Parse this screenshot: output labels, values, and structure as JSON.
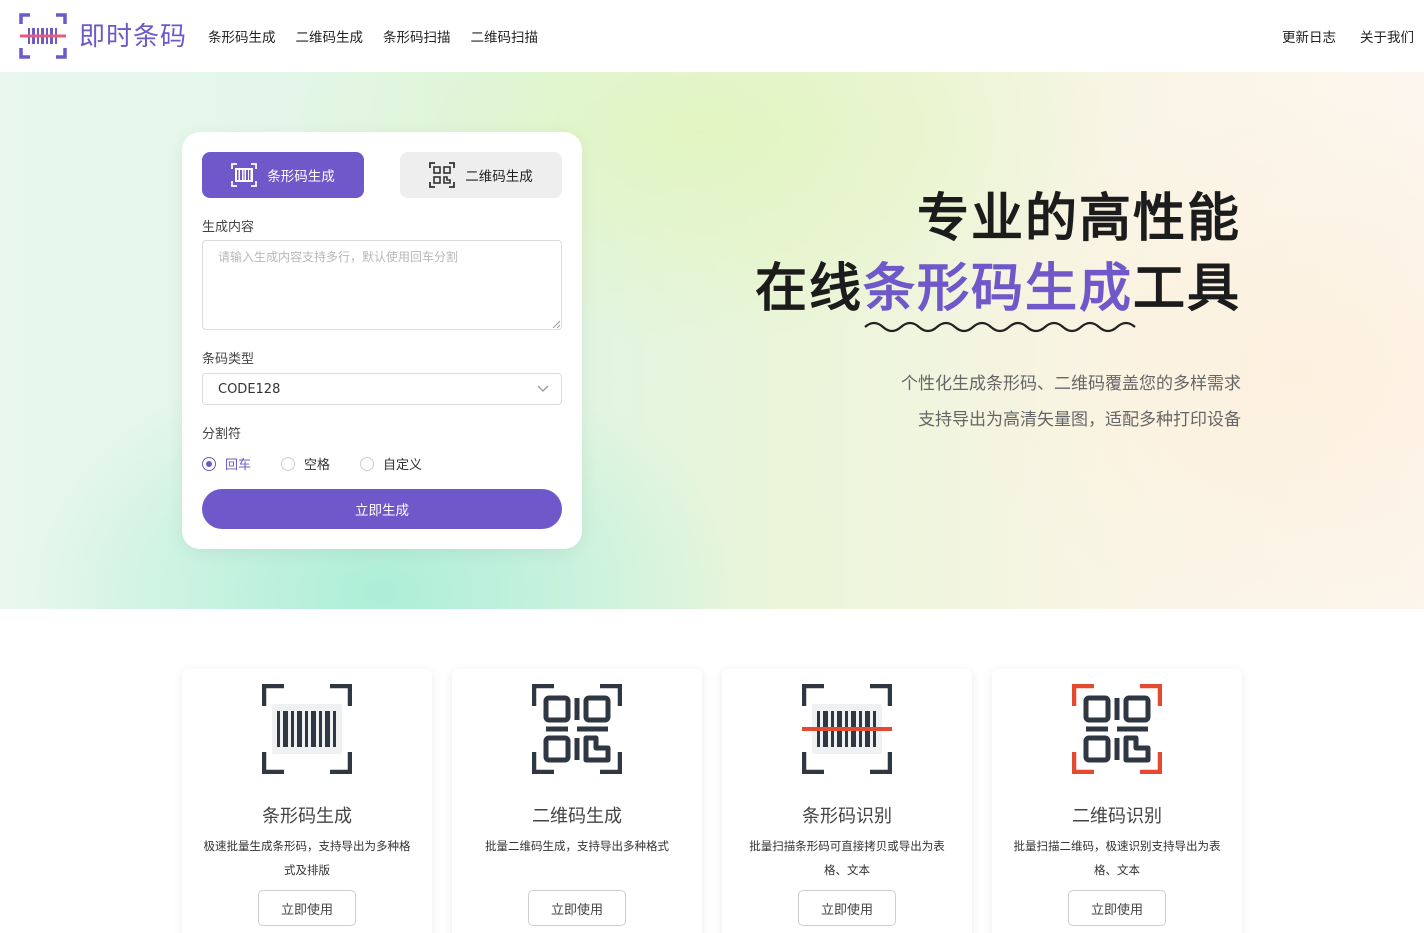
{
  "header": {
    "brand": "即时条码",
    "nav": [
      "条形码生成",
      "二维码生成",
      "条形码扫描",
      "二维码扫描"
    ],
    "nav_right": [
      "更新日志",
      "关于我们"
    ]
  },
  "generator": {
    "tab_barcode": "条形码生成",
    "tab_qrcode": "二维码生成",
    "content_label": "生成内容",
    "content_placeholder": "请输入生成内容支持多行，默认使用回车分割",
    "type_label": "条码类型",
    "type_value": "CODE128",
    "separator_label": "分割符",
    "separators": [
      "回车",
      "空格",
      "自定义"
    ],
    "separator_selected": "回车",
    "generate_label": "立即生成"
  },
  "hero": {
    "line1": "专业的高性能",
    "line2_pre": "在线",
    "line2_accent": "条形码生成",
    "line2_post": "工具",
    "sub1": "个性化生成条形码、二维码覆盖您的多样需求",
    "sub2": "支持导出为高清矢量图，适配多种打印设备"
  },
  "features": [
    {
      "icon": "barcode-icon",
      "title": "条形码生成",
      "desc": "极速批量生成条形码，支持导出为多种格式及排版",
      "button": "立即使用"
    },
    {
      "icon": "qrcode-icon",
      "title": "二维码生成",
      "desc": "批量二维码生成，支持导出多种格式",
      "button": "立即使用"
    },
    {
      "icon": "barcode-scan-icon",
      "title": "条形码识别",
      "desc": "批量扫描条形码可直接拷贝或导出为表格、文本",
      "button": "立即使用"
    },
    {
      "icon": "qrcode-scan-icon",
      "title": "二维码识别",
      "desc": "批量扫描二维码，极速识别支持导出为表格、文本",
      "button": "立即使用"
    }
  ],
  "colors": {
    "accent": "#6f58c9",
    "scan_red": "#e44a2f",
    "icon_dark": "#2f3742"
  }
}
